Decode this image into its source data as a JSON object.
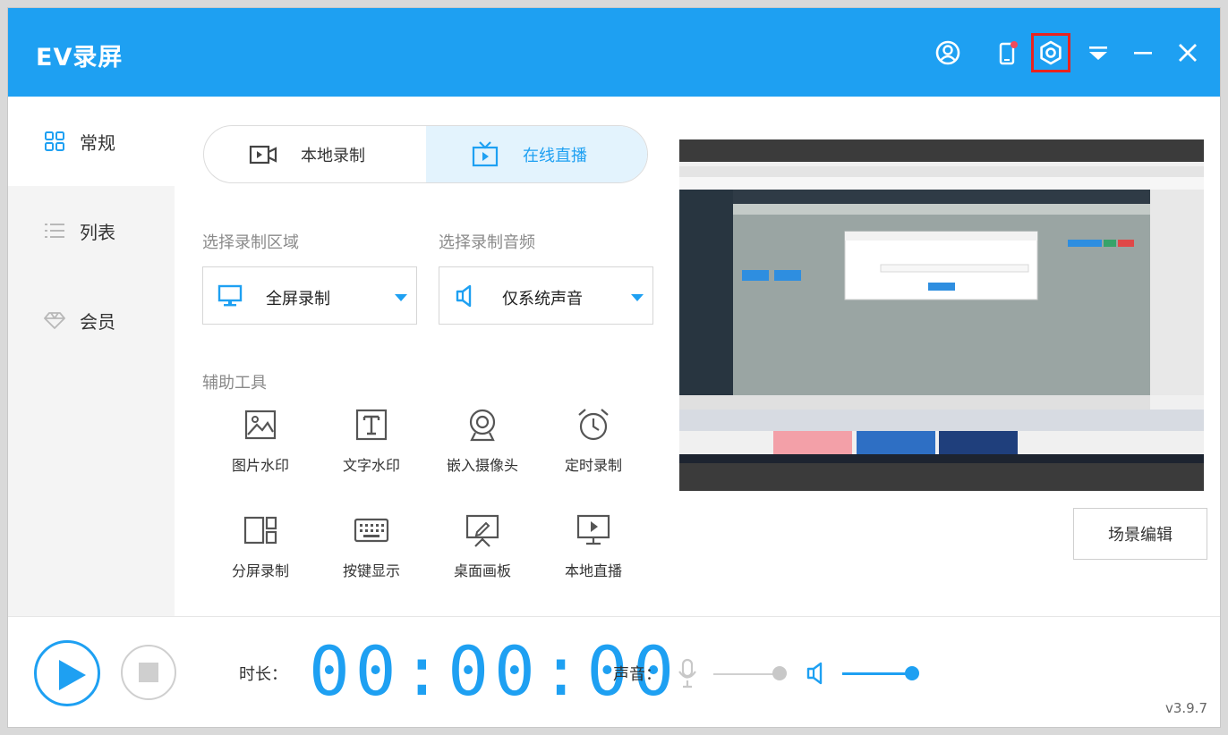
{
  "app": {
    "title": "EV录屏",
    "version": "v3.9.7"
  },
  "titlebar": {
    "icons": [
      "user-icon",
      "phone-icon",
      "settings-icon",
      "dropdown-icon",
      "minimize-icon",
      "close-icon"
    ]
  },
  "sidebar": {
    "items": [
      {
        "label": "常规",
        "icon": "grid-icon",
        "active": true
      },
      {
        "label": "列表",
        "icon": "list-icon",
        "active": false
      },
      {
        "label": "会员",
        "icon": "diamond-icon",
        "active": false
      }
    ]
  },
  "mode": {
    "local": "本地录制",
    "live": "在线直播",
    "active": "live"
  },
  "region": {
    "label": "选择录制区域",
    "value": "全屏录制"
  },
  "audio": {
    "label": "选择录制音频",
    "value": "仅系统声音"
  },
  "tools": {
    "label": "辅助工具",
    "items": [
      {
        "label": "图片水印",
        "icon": "image-watermark-icon"
      },
      {
        "label": "文字水印",
        "icon": "text-watermark-icon"
      },
      {
        "label": "嵌入摄像头",
        "icon": "camera-icon"
      },
      {
        "label": "定时录制",
        "icon": "alarm-clock-icon"
      },
      {
        "label": "分屏录制",
        "icon": "split-screen-icon"
      },
      {
        "label": "按键显示",
        "icon": "keyboard-icon"
      },
      {
        "label": "桌面画板",
        "icon": "easel-icon"
      },
      {
        "label": "本地直播",
        "icon": "monitor-play-icon"
      }
    ]
  },
  "scene_button": "场景编辑",
  "bottom": {
    "duration_label": "时长：",
    "timer": "00:00:00",
    "volume_label": "声音：",
    "mic_level": 1.0,
    "system_level": 1.0
  },
  "colors": {
    "accent": "#1ea0f2",
    "highlight": "#e8231f"
  }
}
